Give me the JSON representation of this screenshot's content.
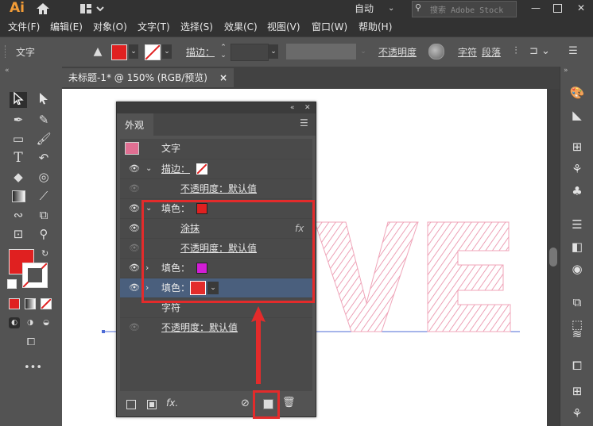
{
  "app": {
    "logo": "Ai",
    "workspace": "自动",
    "search_placeholder": "搜索 Adobe Stock"
  },
  "menu": [
    "文件(F)",
    "编辑(E)",
    "对象(O)",
    "文字(T)",
    "选择(S)",
    "效果(C)",
    "视图(V)",
    "窗口(W)",
    "帮助(H)"
  ],
  "control": {
    "tool_label": "文字",
    "stroke_label": "描边：",
    "opacity_label": "不透明度",
    "char_label": "字符",
    "para_label": "段落"
  },
  "document": {
    "tab_title": "未标题-1* @ 150% (RGB/预览)",
    "close": "×",
    "artwork_text": "VE"
  },
  "panel": {
    "title": "外观",
    "object_label": "文字",
    "rows": [
      {
        "label": "描边：",
        "swatch": "stroke-none"
      },
      {
        "label": "不透明度：默认值",
        "indent": true
      },
      {
        "label": "填色：",
        "swatch": "#e02020"
      },
      {
        "label": "涂抹",
        "fx": "fx"
      },
      {
        "label": "不透明度：默认值",
        "indent": true
      },
      {
        "label": "填色：",
        "swatch": "#d21dd6"
      },
      {
        "label": "填色：",
        "swatch": "#e32b2b"
      },
      {
        "label": "字符"
      },
      {
        "label": "不透明度：默认值"
      }
    ],
    "footer_fx": "fx."
  },
  "colors": {
    "accent_red": "#e32b2b",
    "selection": "#4a5f7d",
    "artwork_pink": "#e88aa4"
  }
}
